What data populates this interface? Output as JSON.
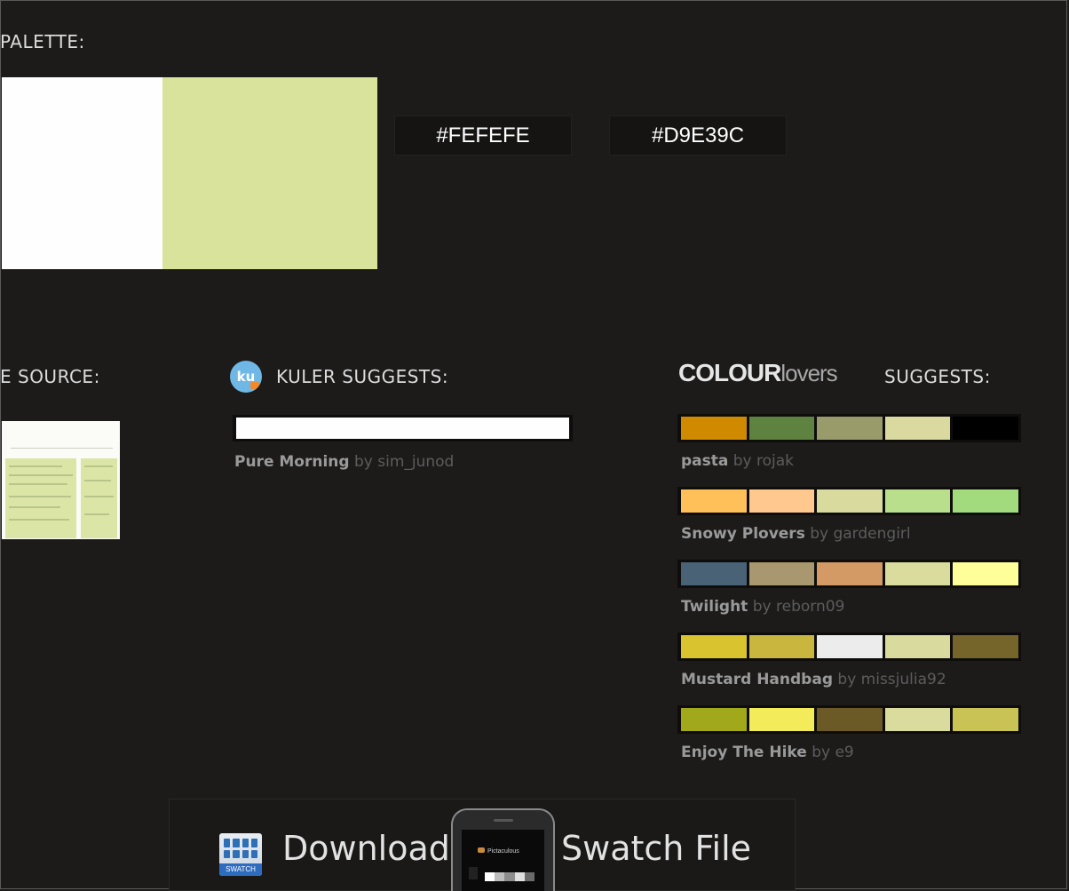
{
  "palette": {
    "heading": "PALETTE:",
    "colors": [
      {
        "hex": "#FEFEFE"
      },
      {
        "hex": "#D9E39C"
      }
    ]
  },
  "source": {
    "heading": "E SOURCE:"
  },
  "kuler": {
    "icon_text": "ku",
    "heading": "KULER SUGGESTS:",
    "palette": {
      "name": "Pure Morning",
      "by": "by sim_junod",
      "colors": [
        "#FEFEFE"
      ]
    }
  },
  "colourlovers": {
    "logo_bold": "COLOUR",
    "logo_light": "lovers",
    "heading": "SUGGESTS:",
    "palettes": [
      {
        "name": "pasta",
        "by": "by rojak",
        "colors": [
          "#D08A00",
          "#5E8240",
          "#9A9B6B",
          "#D9D9A0",
          "#000000"
        ]
      },
      {
        "name": "Snowy Plovers",
        "by": "by gardengirl",
        "colors": [
          "#FFC05A",
          "#FFC88E",
          "#D9DB9E",
          "#BADF8C",
          "#A2DA7E"
        ]
      },
      {
        "name": "Twilight",
        "by": "by reborn09",
        "colors": [
          "#496276",
          "#A8976F",
          "#D49A66",
          "#DADC9E",
          "#FFFF99"
        ]
      },
      {
        "name": "Mustard Handbag",
        "by": "by missjulia92",
        "colors": [
          "#D9C430",
          "#C8B63F",
          "#ECECEC",
          "#D9DB9E",
          "#76652A"
        ]
      },
      {
        "name": "Enjoy The Hike",
        "by": "by e9",
        "colors": [
          "#A1A81A",
          "#F3EB59",
          "#6B5A25",
          "#DADC9E",
          "#C8C354"
        ]
      }
    ]
  },
  "download": {
    "text_left": "Download",
    "text_right": "Swatch File",
    "icon_label": "SWATCH",
    "phone_app_title": "Pictaculous"
  }
}
